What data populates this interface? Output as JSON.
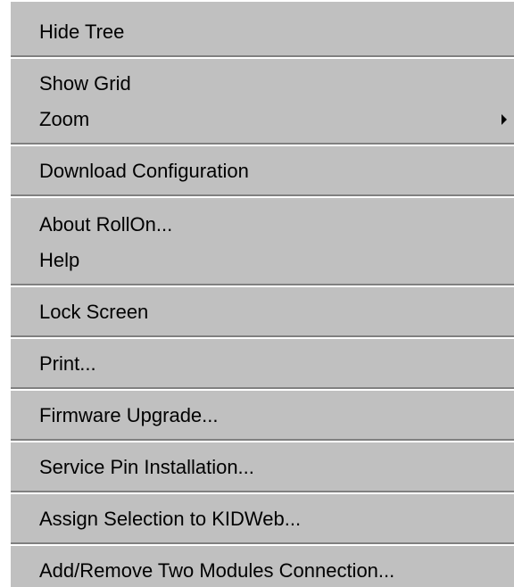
{
  "menu": {
    "items": [
      {
        "label": "Hide Tree"
      },
      {
        "label": "Show Grid"
      },
      {
        "label": "Zoom"
      },
      {
        "label": "Download Configuration"
      },
      {
        "label": "About RollOn..."
      },
      {
        "label": "Help"
      },
      {
        "label": "Lock Screen"
      },
      {
        "label": "Print..."
      },
      {
        "label": "Firmware Upgrade..."
      },
      {
        "label": "Service Pin Installation..."
      },
      {
        "label": "Assign Selection to KIDWeb..."
      },
      {
        "label": "Add/Remove Two Modules Connection..."
      }
    ]
  }
}
